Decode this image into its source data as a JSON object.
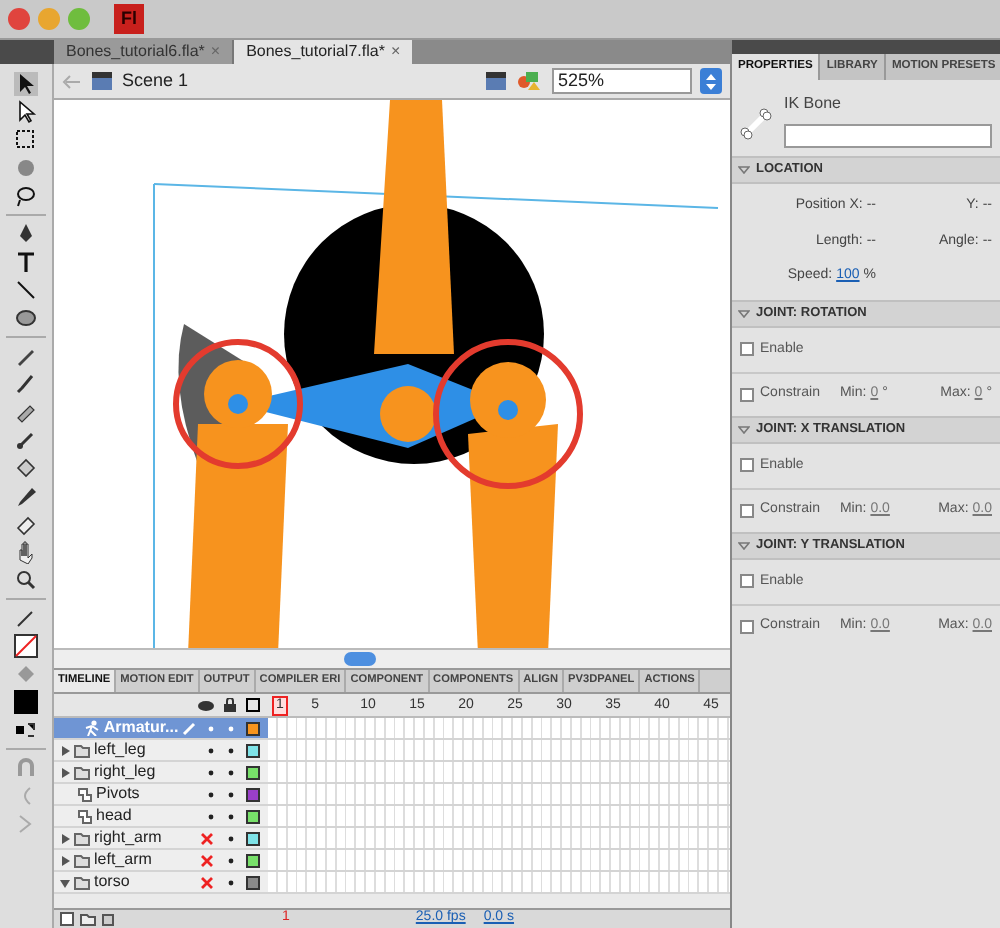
{
  "app_logo": "Fl",
  "doc_tabs": [
    {
      "label": "Bones_tutorial6.fla*",
      "close": "×",
      "selected": false
    },
    {
      "label": "Bones_tutorial7.fla*",
      "close": "×",
      "selected": true
    }
  ],
  "edit_bar": {
    "scene": "Scene 1",
    "zoom": "525%"
  },
  "timeline": {
    "tabs": [
      {
        "label": "TIMELINE",
        "selected": true
      },
      {
        "label": "MOTION EDIT",
        "selected": false
      },
      {
        "label": "OUTPUT",
        "selected": false
      },
      {
        "label": "COMPILER ERI",
        "selected": false
      },
      {
        "label": "COMPONENT",
        "selected": false
      },
      {
        "label": "COMPONENTS",
        "selected": false
      },
      {
        "label": "ALIGN",
        "selected": false
      },
      {
        "label": "PV3DPANEL",
        "selected": false
      },
      {
        "label": "ACTIONS",
        "selected": false
      }
    ],
    "frame_numbers": [
      "1",
      "5",
      "10",
      "15",
      "20",
      "25",
      "30",
      "35",
      "40",
      "45"
    ],
    "layers": [
      {
        "name": "Armatur...",
        "kind": "armature",
        "selected": true,
        "hidden": false,
        "color": "#f7941d"
      },
      {
        "name": "left_leg",
        "kind": "folder",
        "expanded": false,
        "selected": false,
        "hidden": false,
        "color": "#7fe3e8"
      },
      {
        "name": "right_leg",
        "kind": "folder",
        "expanded": false,
        "selected": false,
        "hidden": false,
        "color": "#78e06a"
      },
      {
        "name": "Pivots",
        "kind": "layer",
        "selected": false,
        "hidden": false,
        "color": "#9a3fc9"
      },
      {
        "name": "head",
        "kind": "layer",
        "selected": false,
        "hidden": false,
        "color": "#78e06a"
      },
      {
        "name": "right_arm",
        "kind": "folder",
        "expanded": false,
        "selected": false,
        "hidden": true,
        "color": "#7fe3e8"
      },
      {
        "name": "left_arm",
        "kind": "folder",
        "expanded": false,
        "selected": false,
        "hidden": true,
        "color": "#78e06a"
      },
      {
        "name": "torso",
        "kind": "folder",
        "expanded": true,
        "selected": false,
        "hidden": true,
        "color": "#8a8a8a"
      }
    ],
    "current_frame": "1",
    "fps": "25.0 fps",
    "elapsed": "0.0 s"
  },
  "properties": {
    "tabs": [
      {
        "label": "PROPERTIES",
        "selected": true
      },
      {
        "label": "LIBRARY",
        "selected": false
      },
      {
        "label": "MOTION PRESETS",
        "selected": false
      }
    ],
    "object_type": "IK Bone",
    "sections": [
      {
        "title": "LOCATION",
        "rows": [
          [
            {
              "label": "Position X:",
              "value": "--"
            },
            {
              "label": "Y:",
              "value": "--"
            }
          ],
          [
            {
              "label": "Length:",
              "value": "--"
            },
            {
              "label": "Angle:",
              "value": "--"
            }
          ],
          [
            {
              "label": "Speed:",
              "value": "100",
              "unit": "%",
              "link": true
            }
          ]
        ]
      },
      {
        "title": "JOINT: ROTATION",
        "enable": {
          "label": "Enable",
          "checked": false
        },
        "constrain": {
          "label": "Constrain",
          "checked": false,
          "min_label": "Min:",
          "min": "0",
          "max_label": "Max:",
          "max": "0",
          "unit": "°"
        }
      },
      {
        "title": "JOINT: X TRANSLATION",
        "enable": {
          "label": "Enable",
          "checked": false
        },
        "constrain": {
          "label": "Constrain",
          "checked": false,
          "min_label": "Min:",
          "min": "0.0",
          "max_label": "Max:",
          "max": "0.0"
        }
      },
      {
        "title": "JOINT: Y TRANSLATION",
        "enable": {
          "label": "Enable",
          "checked": false
        },
        "constrain": {
          "label": "Constrain",
          "checked": false,
          "min_label": "Min:",
          "min": "0.0",
          "max_label": "Max:",
          "max": "0.0"
        }
      }
    ]
  }
}
